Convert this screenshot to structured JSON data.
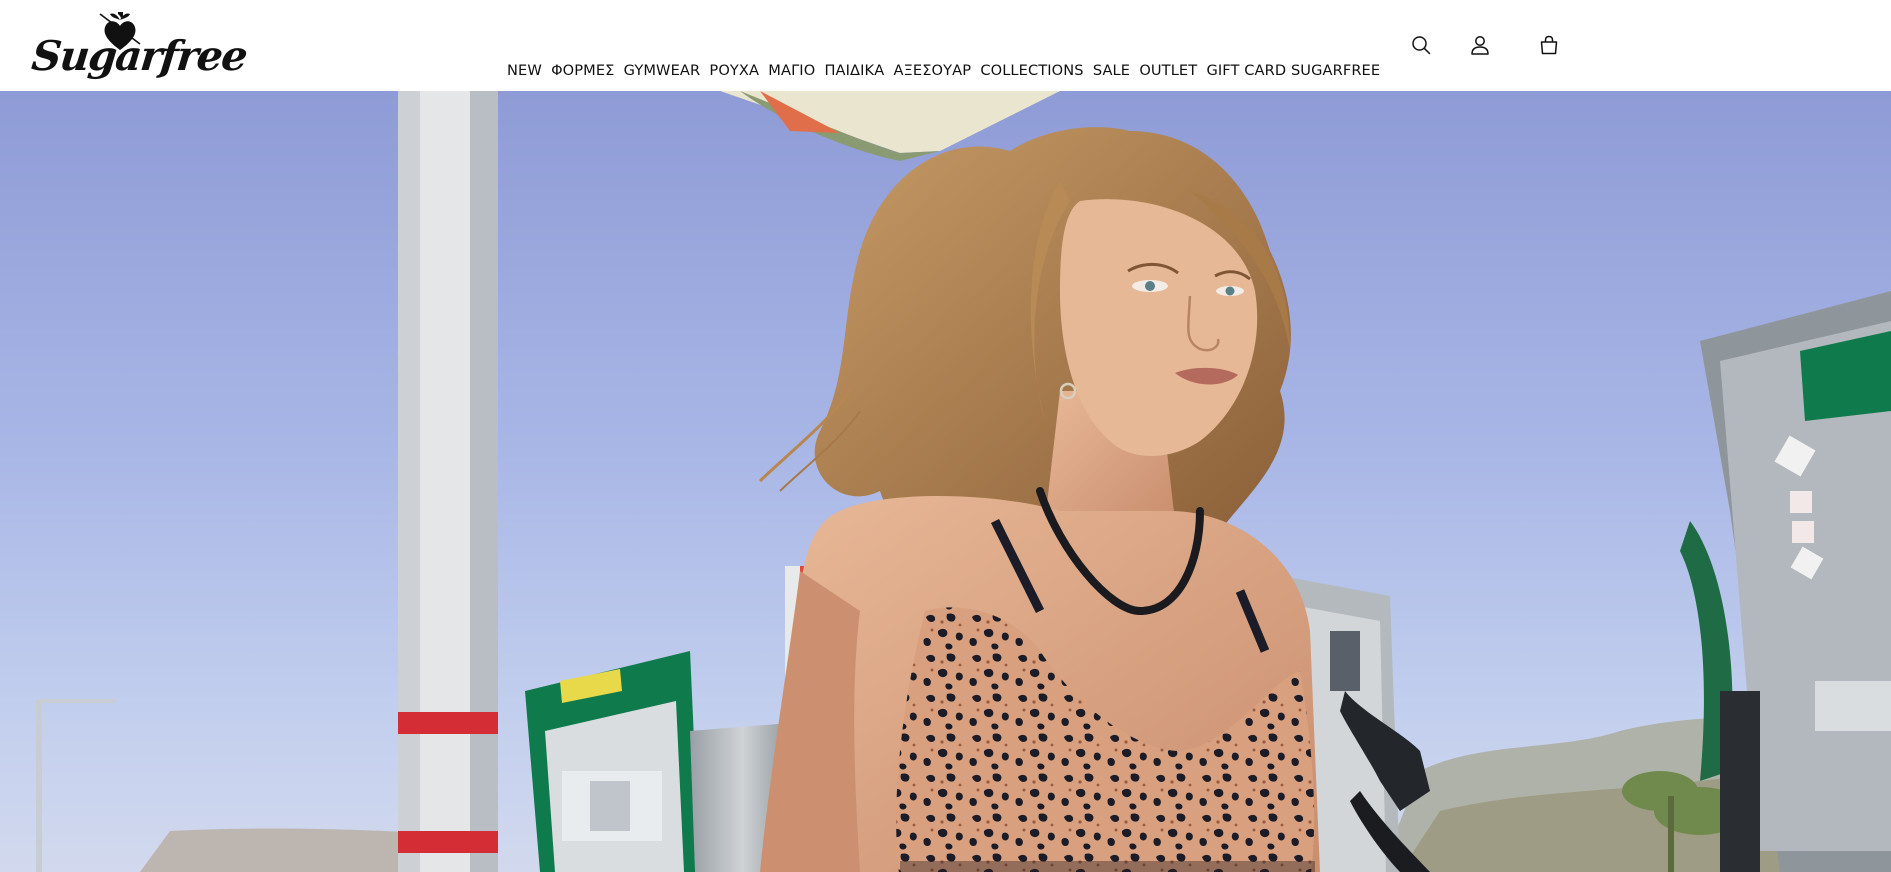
{
  "brand": {
    "name": "Sugarfree",
    "logo_icon": "heart-dagger-icon"
  },
  "nav": {
    "items": [
      {
        "label": "NEW"
      },
      {
        "label": "ΦΟΡΜΕΣ"
      },
      {
        "label": "GYMWEAR"
      },
      {
        "label": "ΡΟΥΧΑ"
      },
      {
        "label": "ΜΑΓΙΟ"
      },
      {
        "label": "ΠΑΙΔΙΚΑ"
      },
      {
        "label": "ΑΞΕΣΟΥΑΡ"
      },
      {
        "label": "COLLECTIONS"
      },
      {
        "label": "SALE"
      },
      {
        "label": "OUTLET"
      },
      {
        "label": "GIFT CARD SUGARFREE"
      }
    ]
  },
  "header_icons": {
    "search": "search-icon",
    "account": "user-icon",
    "cart": "shopping-bag-icon"
  },
  "hero": {
    "image": "campaign-model-leopard-sports-bra-at-gas-station",
    "colors": {
      "sky": "#a9b8e6",
      "pump_green": "#0f7a4c",
      "leopard_base": "#d69a7a"
    }
  },
  "colors": {
    "text": "#111111",
    "header_bg": "#ffffff"
  }
}
